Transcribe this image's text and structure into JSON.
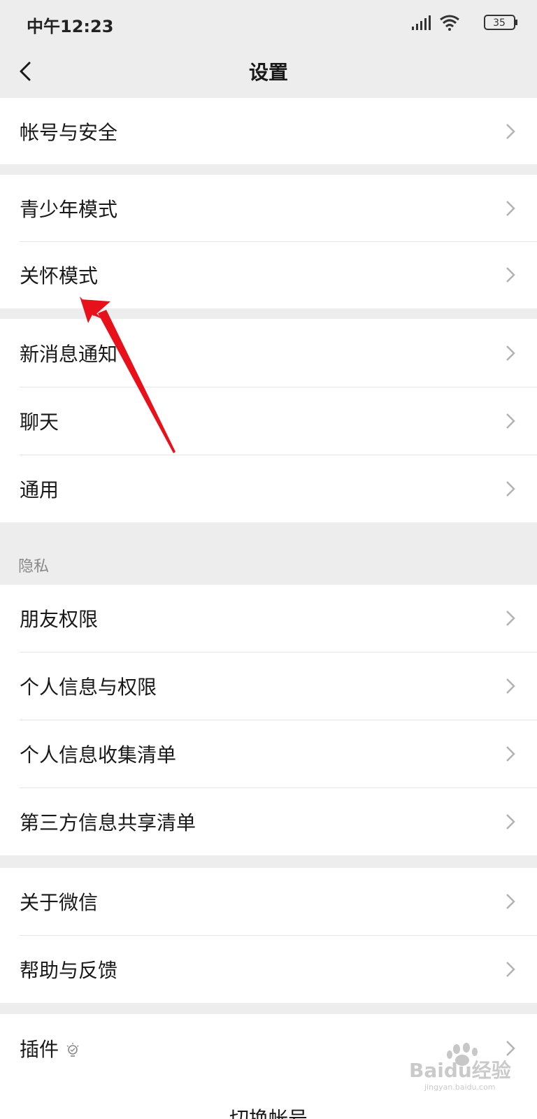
{
  "status_bar": {
    "time": "中午12:23",
    "battery": "35",
    "icons": [
      "signal-icon",
      "wifi-icon",
      "battery-icon"
    ]
  },
  "nav": {
    "title": "设置",
    "back_icon": "back-chevron-icon"
  },
  "groups": [
    {
      "items": [
        {
          "label": "帐号与安全"
        }
      ]
    },
    {
      "items": [
        {
          "label": "青少年模式"
        },
        {
          "label": "关怀模式"
        }
      ]
    },
    {
      "items": [
        {
          "label": "新消息通知"
        },
        {
          "label": "聊天"
        },
        {
          "label": "通用"
        }
      ]
    },
    {
      "header": "隐私",
      "items": [
        {
          "label": "朋友权限"
        },
        {
          "label": "个人信息与权限"
        },
        {
          "label": "个人信息收集清单"
        },
        {
          "label": "第三方信息共享清单"
        }
      ]
    },
    {
      "items": [
        {
          "label": "关于微信"
        },
        {
          "label": "帮助与反馈"
        }
      ]
    },
    {
      "items": [
        {
          "label": "插件",
          "icon": "lightbulb-icon"
        }
      ]
    }
  ],
  "bottom_partial_label": "切换帐号",
  "watermark": {
    "text": "Baidu经验",
    "subtext": "jingyan.baidu.com"
  },
  "colors": {
    "background": "#ededed",
    "row_background": "#ffffff",
    "text": "#191919",
    "secondary_text": "#888888",
    "chevron": "#b2b2b2",
    "annotation_arrow": "#e8101a"
  }
}
